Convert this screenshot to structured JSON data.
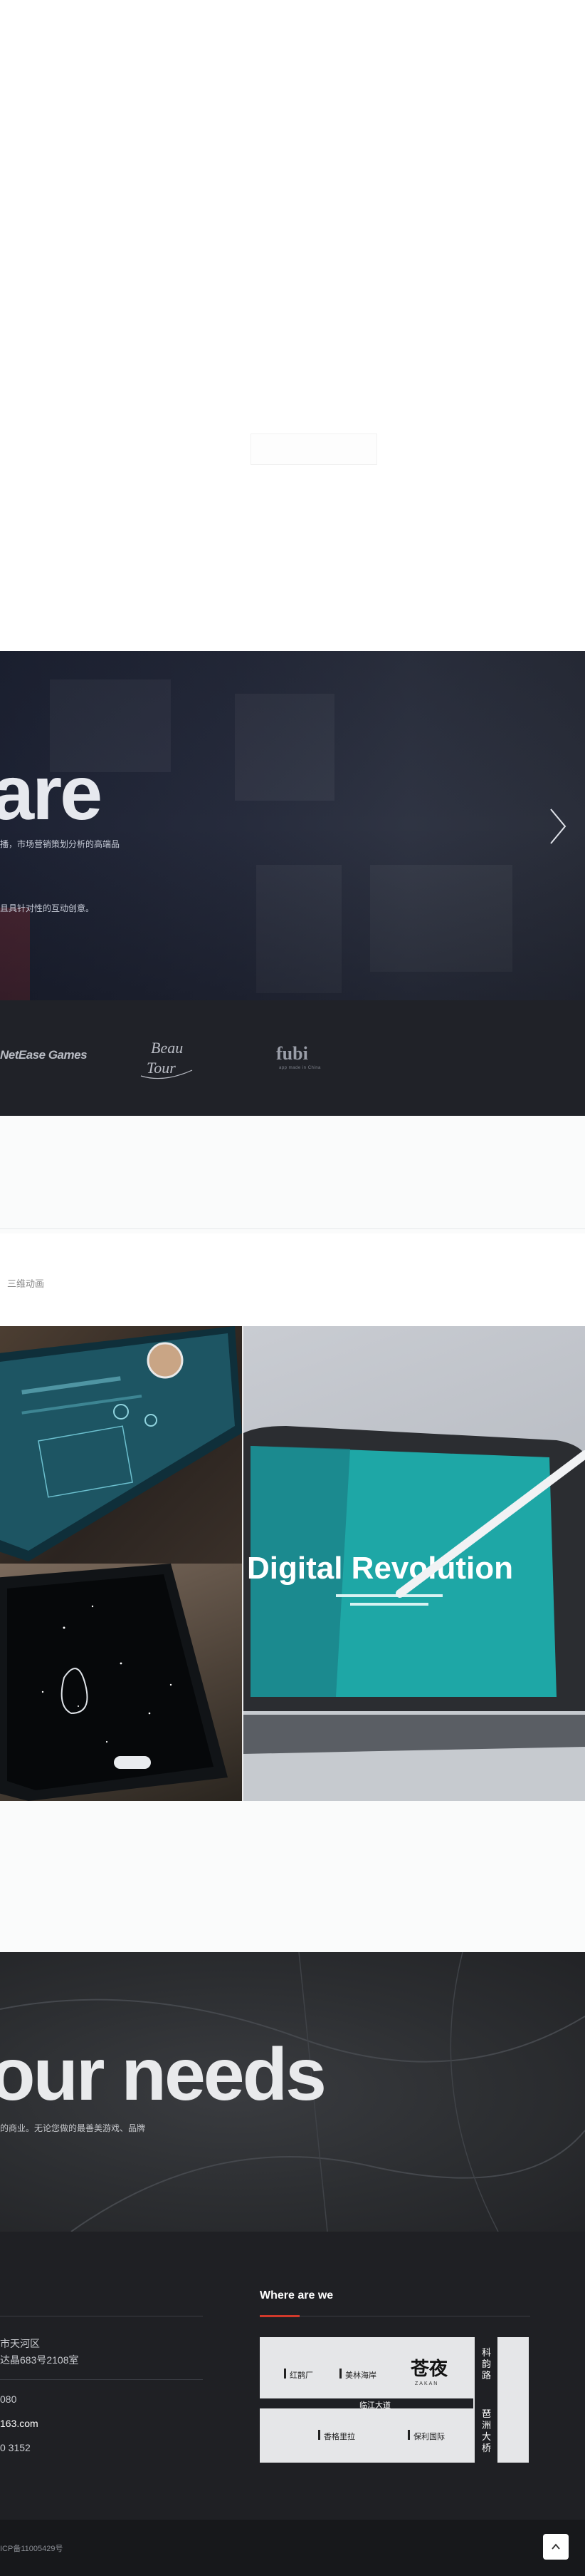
{
  "hero": {
    "headline": "are",
    "line1": "播，市场营销策划分析的高端品",
    "line2": "且具针对性的互动创意。",
    "next_icon": "chevron-right-icon"
  },
  "clients": {
    "netease": "NetEase Games",
    "beau_tour": "Beau Tour",
    "fubi": "fubi",
    "fubi_sub": "app made in China"
  },
  "filter": {
    "label": "三维动画"
  },
  "gallery": {
    "tile_c_headline": "Digital Revolution"
  },
  "needs": {
    "headline": "our needs",
    "subtitle": "的商业。无论您做的最善美游戏、品牌"
  },
  "footer": {
    "address_line1": "市天河区",
    "address_line2": "达晶683号2108室",
    "tel": "080",
    "email": "163.com",
    "fax": "0 3152",
    "where_title": "Where are we",
    "map": {
      "label_a": "红鹊厂",
      "label_b": "美林海岸",
      "logo": "苍夜",
      "logo_sub": "ZAKAN",
      "road_h": "临江大道",
      "label_c": "香格里拉",
      "label_d": "保利国际",
      "road_v1": "科韵路",
      "road_v2": "琶洲大桥"
    },
    "icp": "ICP备11005429号",
    "to_top_icon": "arrow-up-icon"
  },
  "colors": {
    "accent": "#d0392b",
    "footer_bg": "#1f2024"
  }
}
